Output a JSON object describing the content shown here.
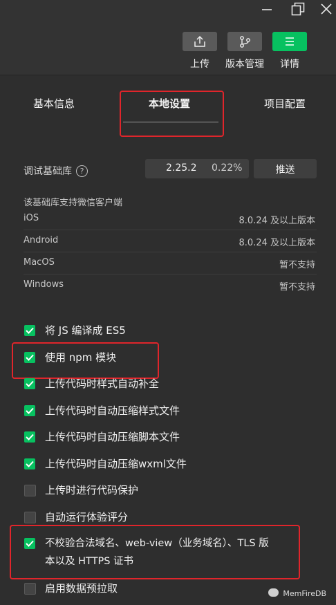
{
  "toolbar": {
    "upload_label": "上传",
    "version_label": "版本管理",
    "details_label": "详情"
  },
  "tabs": {
    "basic": "基本信息",
    "local": "本地设置",
    "project": "项目配置"
  },
  "debug_lib": {
    "label": "调试基础库",
    "help": "?",
    "version": "2.25.2",
    "percent": "0.22%",
    "push_button": "推送"
  },
  "client_support": {
    "heading": "该基础库支持微信客户端",
    "rows": [
      {
        "platform": "iOS",
        "value": "8.0.24 及以上版本"
      },
      {
        "platform": "Android",
        "value": "8.0.24 及以上版本"
      },
      {
        "platform": "MacOS",
        "value": "暂不支持"
      },
      {
        "platform": "Windows",
        "value": "暂不支持"
      }
    ]
  },
  "options": [
    {
      "label": "将 JS 编译成 ES5",
      "checked": true
    },
    {
      "label": "使用 npm 模块",
      "checked": true
    },
    {
      "label": "上传代码时样式自动补全",
      "checked": true
    },
    {
      "label": "上传代码时自动压缩样式文件",
      "checked": true
    },
    {
      "label": "上传代码时自动压缩脚本文件",
      "checked": true
    },
    {
      "label": "上传代码时自动压缩wxml文件",
      "checked": true
    },
    {
      "label": "上传时进行代码保护",
      "checked": false
    },
    {
      "label": "自动运行体验评分",
      "checked": false
    },
    {
      "label_line1": "不校验合法域名、web-view（业务域名）、TLS 版",
      "label_line2": "本以及 HTTPS 证书",
      "checked": true
    },
    {
      "label": "启用数据预拉取",
      "checked": false
    }
  ],
  "watermark": "MemFireDB",
  "colors": {
    "accent_green": "#07c160",
    "highlight_red": "#e0252b",
    "background": "#2e2e2e"
  },
  "icons": {
    "minimize": "minimize-icon",
    "restore": "restore-icon",
    "close": "close-icon",
    "upload": "upload-icon",
    "version": "branch-icon",
    "details": "menu-icon"
  }
}
